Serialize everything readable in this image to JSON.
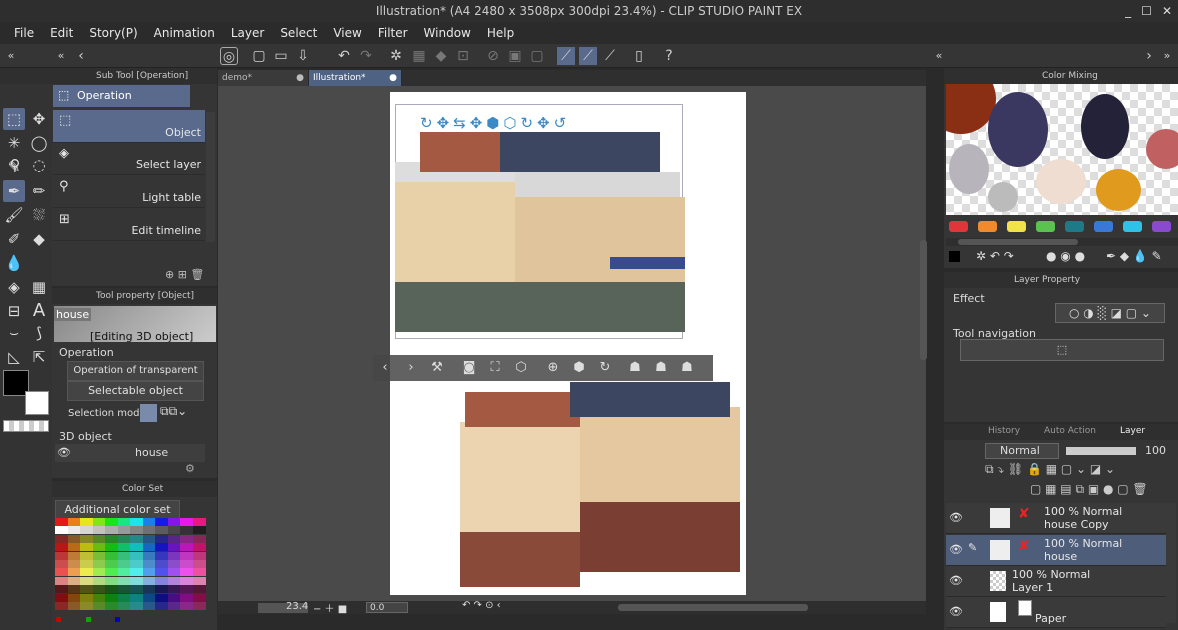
{
  "window": {
    "title": "Illustration* (A4 2480 x 3508px 300dpi 23.4%) - CLIP STUDIO PAINT EX",
    "controls": [
      "_",
      "☐",
      "✕"
    ]
  },
  "menu": [
    "File",
    "Edit",
    "Story(P)",
    "Animation",
    "Layer",
    "Select",
    "View",
    "Filter",
    "Window",
    "Help"
  ],
  "tabs": [
    {
      "label": "demo*"
    },
    {
      "label": "Illustration*"
    }
  ],
  "subtool": {
    "header": "Sub Tool [Operation]",
    "group": "Operation",
    "items": [
      "Object",
      "Select layer",
      "Light table",
      "Edit timeline"
    ]
  },
  "toolprop": {
    "header": "Tool property [Object]",
    "layer_name": "house",
    "editing": "[Editing 3D object]",
    "section": "Operation",
    "transparent": "Operation of transparent part",
    "selectable": "Selectable object",
    "selmode_label": "Selection mode",
    "obj_section": "3D object",
    "obj_name": "house"
  },
  "colorset": {
    "header": "Color Set",
    "select": "Additional color set"
  },
  "canvas": {
    "zoom": "23.4",
    "angle": "0.0"
  },
  "colormix": {
    "header": "Color Mixing",
    "swatches": [
      "#e0363a",
      "#f08a2c",
      "#f2e24a",
      "#5ac24e",
      "#1e7a86",
      "#3a78d8",
      "#2ec2e6",
      "#8a4ad0"
    ]
  },
  "layerprop": {
    "header": "Layer Property",
    "effect": "Effect",
    "nav": "Tool navigation"
  },
  "layerpanel": {
    "tabs": [
      "History",
      "Auto Action",
      "Layer"
    ],
    "blend": "Normal",
    "opacity": "100"
  },
  "layers": [
    {
      "mode": "100 % Normal",
      "name": "house Copy"
    },
    {
      "mode": "100 % Normal",
      "name": "house"
    },
    {
      "mode": "100 % Normal",
      "name": "Layer 1"
    },
    {
      "mode": "",
      "name": "Paper"
    }
  ]
}
